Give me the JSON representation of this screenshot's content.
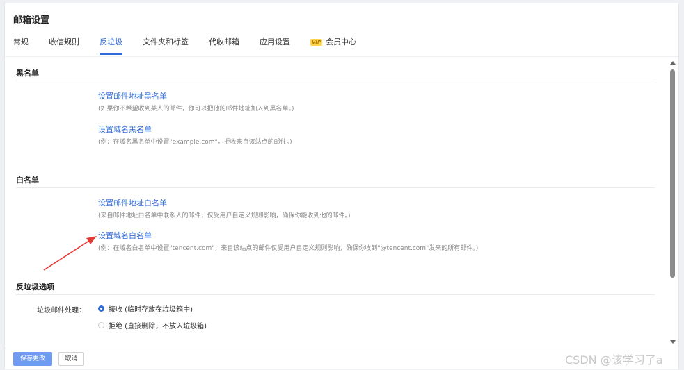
{
  "page": {
    "title": "邮箱设置"
  },
  "tabs": [
    {
      "label": "常规"
    },
    {
      "label": "收信规则"
    },
    {
      "label": "反垃圾"
    },
    {
      "label": "文件夹和标签"
    },
    {
      "label": "代收邮箱"
    },
    {
      "label": "应用设置"
    },
    {
      "label": "会员中心",
      "badge": "VIP"
    }
  ],
  "active_tab": "反垃圾",
  "blacklist": {
    "heading": "黑名单",
    "address_link": "设置邮件地址黑名单",
    "address_desc": "(如果你不希望收到某人的邮件，你可以把他的邮件地址加入到黑名单。)",
    "domain_link": "设置域名黑名单",
    "domain_desc": "(例：在域名黑名单中设置\"example.com\"，拒收来自该站点的邮件。)"
  },
  "whitelist": {
    "heading": "白名单",
    "address_link": "设置邮件地址白名单",
    "address_desc": "(来自邮件地址白名单中联系人的邮件，仅受用户自定义规则影响，确保你能收到他的邮件。)",
    "domain_link": "设置域名白名单",
    "domain_desc": "(例：在域名白名单中设置\"tencent.com\"，来自该站点的邮件仅受用户自定义规则影响，确保你收到\"@tencent.com\"发来的所有邮件。)"
  },
  "antispam": {
    "heading": "反垃圾选项",
    "label": "垃圾邮件处理：",
    "options": [
      {
        "label": "接收 (临时存放在垃圾箱中)",
        "checked": true
      },
      {
        "label": "拒绝 (直接删除，不放入垃圾箱)",
        "checked": false
      }
    ]
  },
  "footer": {
    "save_label": "保存更改",
    "cancel_label": "取消"
  },
  "watermark": "CSDN @该学习了a",
  "colors": {
    "accent": "#2f6bd8",
    "save_button": "#6f9bf0",
    "annotation_arrow": "#e53935"
  }
}
